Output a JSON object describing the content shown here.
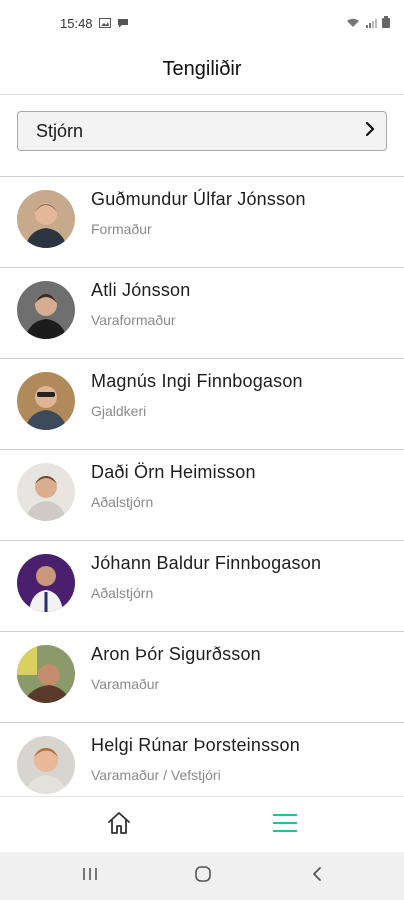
{
  "status": {
    "time": "15:48"
  },
  "header": {
    "title": "Tengiliðir"
  },
  "selector": {
    "label": "Stjórn"
  },
  "contacts": [
    {
      "name": "Guðmundur Úlfar Jónsson",
      "role": "Formaður",
      "avatar_bg": "#c7a98c",
      "shirt": "#2b3440"
    },
    {
      "name": "Atli Jónsson",
      "role": "Varaformaður",
      "avatar_bg": "#6f6f6f",
      "shirt": "#1c1c1c"
    },
    {
      "name": "Magnús Ingi Finnbogason",
      "role": "Gjaldkeri",
      "avatar_bg": "#b08a5a",
      "shirt": "#3d4a5a"
    },
    {
      "name": "Daði Örn Heimisson",
      "role": "Aðalstjórn",
      "avatar_bg": "#e8e4e0",
      "shirt": "#cfcac4"
    },
    {
      "name": "Jóhann Baldur Finnbogason",
      "role": "Aðalstjórn",
      "avatar_bg": "#4a1f6e",
      "shirt": "#f2f2f2"
    },
    {
      "name": "Aron Þór Sigurðsson",
      "role": "Varamaður",
      "avatar_bg": "#8a9a6a",
      "shirt": "#5a3a2a"
    },
    {
      "name": "Helgi Rúnar Þorsteinsson",
      "role": "Varamaður / Vefstjóri",
      "avatar_bg": "#d8d4d0",
      "shirt": "#e4e0dc"
    }
  ],
  "tabs": [
    {
      "icon": "home-icon",
      "color": "#333333"
    },
    {
      "icon": "menu-icon",
      "color": "#2bbf8a"
    }
  ],
  "colors": {
    "accent": "#2bbf8a"
  }
}
